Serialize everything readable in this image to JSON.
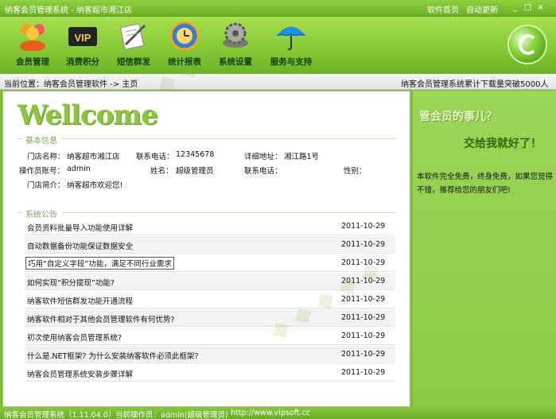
{
  "window": {
    "title": "纳客会员管理系统 - 纳客超市湘江店",
    "links": [
      "软件首页",
      "自动更新"
    ],
    "controls": [
      "_",
      "□",
      "×"
    ]
  },
  "toolbar": {
    "items": [
      {
        "label": "会员管理",
        "icon": "members-icon"
      },
      {
        "label": "消费积分",
        "icon": "vip-card-icon"
      },
      {
        "label": "短信群发",
        "icon": "notepad-pen-icon"
      },
      {
        "label": "统计报表",
        "icon": "globe-clock-icon"
      },
      {
        "label": "系统设置",
        "icon": "gear-disk-icon"
      },
      {
        "label": "服务与支持",
        "icon": "umbrella-icon"
      }
    ]
  },
  "breadcrumb": {
    "text": "当前位置：纳客会员管理软件 -> 主页",
    "downloads": "纳客会员管理系统累计下载量突破5000人次"
  },
  "main": {
    "welcome": "Wellcome",
    "basic_section": "基本信息",
    "fields": {
      "store_name_label": "门店名称：",
      "store_name": "纳客超市湘江店",
      "phone_label": "联系电话：",
      "phone": "12345678",
      "address_label": "详细地址：",
      "address": "湘江路1号",
      "operator_label": "操作员账号：",
      "operator": "admin",
      "name_label": "姓名：",
      "name": "超级管理员",
      "op_phone_label": "联系电话：",
      "op_phone": "",
      "gender_label": "性别：",
      "gender": "",
      "intro_label": "门店简介：",
      "intro": "纳客超市欢迎您!"
    },
    "news_section": "系统公告",
    "news": [
      {
        "title": "会员资料批量导入功能使用详解",
        "date": "2011-10-29"
      },
      {
        "title": "自动数据备份功能保证数据安全",
        "date": "2011-10-29"
      },
      {
        "title": "巧用“自定义字段”功能，满足不同行业需求",
        "date": "2011-10-29"
      },
      {
        "title": "如何实现“积分提现”功能?",
        "date": "2011-10-29"
      },
      {
        "title": "纳客软件短信群发功能开通流程",
        "date": "2011-10-29"
      },
      {
        "title": "纳客软件相对于其他会员管理软件有何优势?",
        "date": "2011-10-29"
      },
      {
        "title": "初次使用纳客会员管理系统?",
        "date": "2011-10-29"
      },
      {
        "title": "什么是.NET框架? 为什么安装纳客软件必须此框架?",
        "date": "2011-10-29"
      },
      {
        "title": "纳客会员管理系统安装步骤详解",
        "date": "2011-10-29"
      }
    ]
  },
  "side": {
    "question": "管会员的事儿？",
    "answer": "交给我就好了！",
    "promo": "本软件完全免费，终身免费，如果您觉得不错，推荐给您的朋友们吧!"
  },
  "status": {
    "version": "纳客会员管理系统（1.11.04.0）",
    "operator": "当前操作员：admin(超级管理员)",
    "url": "http://www.vipsoft.cc"
  },
  "colors": {
    "accent": "#8cc63f",
    "dark_green": "#2f6b0a"
  }
}
